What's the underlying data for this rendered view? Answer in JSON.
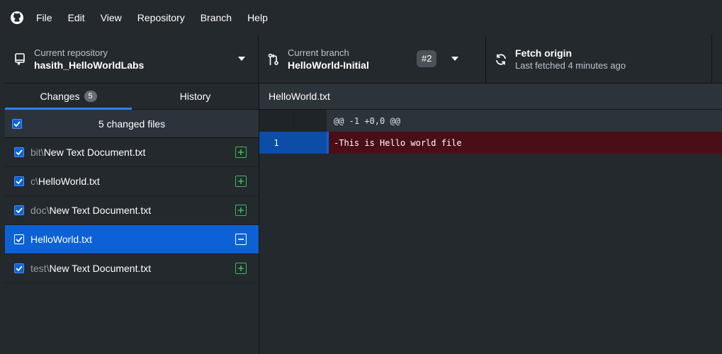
{
  "menu": {
    "items": [
      "File",
      "Edit",
      "View",
      "Repository",
      "Branch",
      "Help"
    ]
  },
  "toolbar": {
    "repo": {
      "label": "Current repository",
      "value": "hasith_HelloWorldLabs"
    },
    "branch": {
      "label": "Current branch",
      "value": "HelloWorld-Initial",
      "pr_badge": "#2"
    },
    "fetch": {
      "title": "Fetch origin",
      "subtitle": "Last fetched 4 minutes ago"
    }
  },
  "tabs": {
    "changes": {
      "label": "Changes",
      "count": "5"
    },
    "history": {
      "label": "History"
    }
  },
  "changes": {
    "header": "5 changed files",
    "files": [
      {
        "dir": "bit\\",
        "name": "New Text Document.txt",
        "status": "added"
      },
      {
        "dir": "c\\",
        "name": "HelloWorld.txt",
        "status": "added"
      },
      {
        "dir": "doc\\",
        "name": "New Text Document.txt",
        "status": "added"
      },
      {
        "dir": "",
        "name": "HelloWorld.txt",
        "status": "deleted",
        "selected": true
      },
      {
        "dir": "test\\",
        "name": "New Text Document.txt",
        "status": "added"
      }
    ]
  },
  "diff": {
    "file": "HelloWorld.txt",
    "hunk": "@@ -1 +0,0 @@",
    "lines": [
      {
        "old": "1",
        "new": "",
        "text": "-This is Hello world file",
        "type": "deleted"
      }
    ]
  },
  "colors": {
    "accent": "#0c61d6",
    "added": "#3bba57",
    "deleted_bg": "#4a0e17"
  }
}
